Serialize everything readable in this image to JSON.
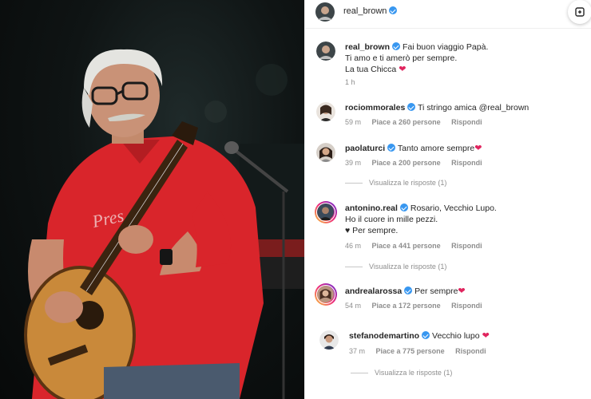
{
  "post": {
    "author": "real_brown",
    "photo_caption_text": "Pres"
  },
  "comments": [
    {
      "username": "real_brown",
      "text": "Fai buon viaggio Papà.\nTi amo e ti amerò per sempre.\nLa tua Chicca",
      "time": "1 h",
      "likes": "",
      "reply_label": "",
      "replies_label": ""
    },
    {
      "username": "rociommorales",
      "text": "Ti stringo amica @real_brown",
      "time": "59 m",
      "likes": "Piace a 260 persone",
      "reply_label": "Rispondi",
      "replies_label": ""
    },
    {
      "username": "paolaturci",
      "text": "Tanto amore sempre",
      "time": "39 m",
      "likes": "Piace a 200 persone",
      "reply_label": "Rispondi",
      "replies_label": "Visualizza le risposte (1)"
    },
    {
      "username": "antonino.real",
      "text": "Rosario, Vecchio Lupo.\nHo il cuore in mille pezzi.\n♥ Per sempre.",
      "time": "46 m",
      "likes": "Piace a 441 persone",
      "reply_label": "Rispondi",
      "replies_label": "Visualizza le risposte (1)"
    },
    {
      "username": "andrealarossa",
      "text": "Per sempre",
      "time": "54 m",
      "likes": "Piace a 172 persone",
      "reply_label": "Rispondi",
      "replies_label": ""
    },
    {
      "username": "stefanodemartino",
      "text": "Vecchio lupo",
      "time": "37 m",
      "likes": "Piace a 775 persone",
      "reply_label": "Rispondi",
      "replies_label": "Visualizza le risposte (1)"
    }
  ],
  "colors": {
    "verified": "#3897f0",
    "heart": "#e0245e",
    "muted": "#8e8e8e",
    "shirt": "#d9252b"
  },
  "icons": {
    "verified": "verified-badge-icon",
    "heart": "red-heart-icon",
    "corner": "share-icon"
  }
}
